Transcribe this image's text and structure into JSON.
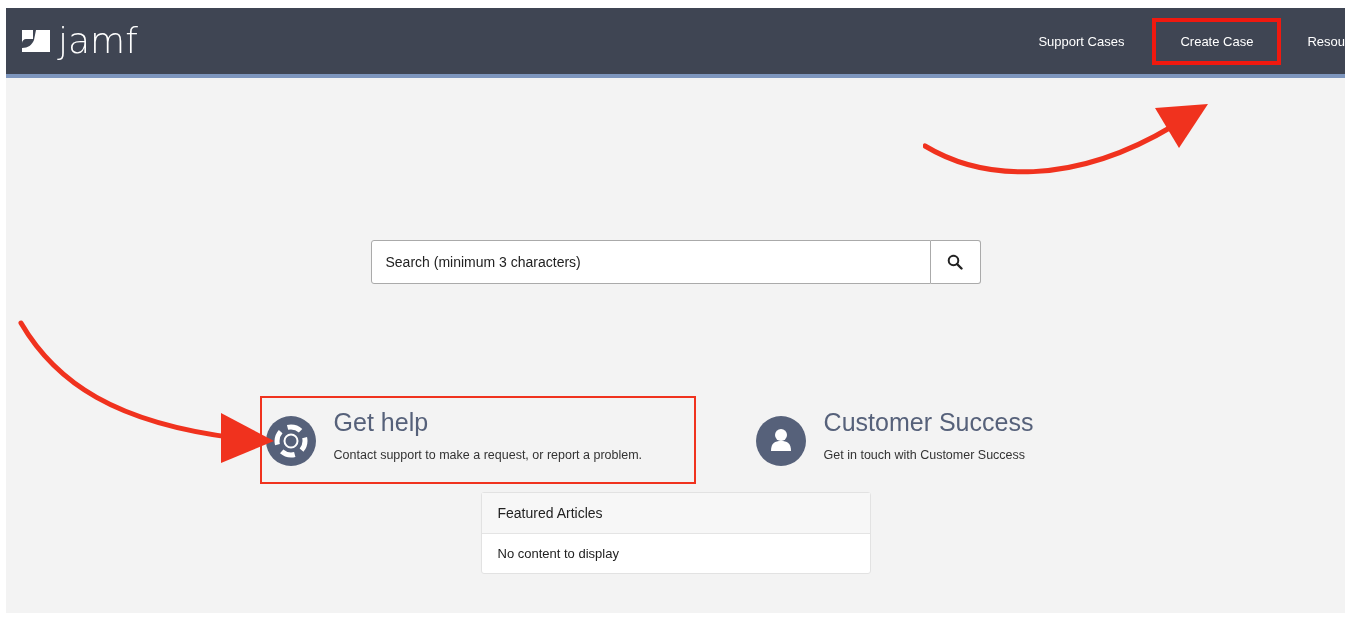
{
  "header": {
    "logo_text": "jamf",
    "nav": [
      {
        "label": "Support Cases",
        "highlighted": false
      },
      {
        "label": "Create Case",
        "highlighted": true
      },
      {
        "label": "Resou",
        "highlighted": false
      }
    ]
  },
  "search": {
    "placeholder": "Search (minimum 3 characters)"
  },
  "cards": [
    {
      "kind": "help",
      "title": "Get help",
      "description": "Contact support to make a request, or report a problem.",
      "highlighted": true
    },
    {
      "kind": "person",
      "title": "Customer Success",
      "description": "Get in touch with Customer Success",
      "highlighted": false
    }
  ],
  "featured": {
    "title": "Featured Articles",
    "empty_text": "No content to display"
  },
  "annotations": [
    {
      "kind": "arrow-up-right"
    },
    {
      "kind": "arrow-down-right"
    }
  ]
}
